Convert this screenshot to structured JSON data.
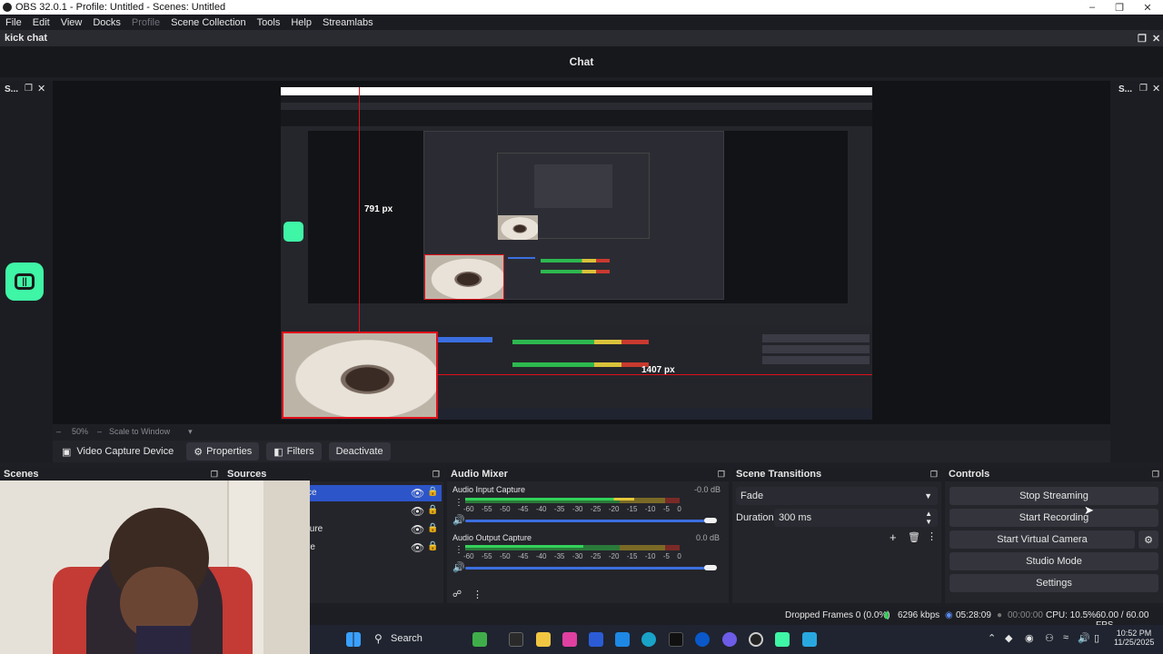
{
  "window": {
    "title": "OBS 32.0.1 - Profile: Untitled - Scenes: Untitled"
  },
  "menu": [
    "File",
    "Edit",
    "View",
    "Docks",
    "Profile",
    "Scene Collection",
    "Tools",
    "Help",
    "Streamlabs"
  ],
  "dock_title": "kick chat",
  "chat": {
    "title": "Chat"
  },
  "left_dock": {
    "label": "S..."
  },
  "right_dock": {
    "label": "S..."
  },
  "preview": {
    "measure_vertical": "791 px",
    "measure_horizontal": "1407 px"
  },
  "zoom": {
    "value": "50%",
    "mode": "Scale to Window"
  },
  "source_toolbar": {
    "source_name": "Video Capture Device",
    "properties": "Properties",
    "filters": "Filters",
    "deactivate": "Deactivate"
  },
  "docks": {
    "scenes": "Scenes",
    "sources": "Sources",
    "audio_mixer": "Audio Mixer",
    "scene_transitions": "Scene Transitions",
    "controls": "Controls"
  },
  "sources_list": [
    "ce",
    "",
    "ture",
    "re"
  ],
  "mixer": {
    "channels": [
      {
        "name": "Audio Input Capture",
        "db": "-0.0 dB",
        "level": 0.78
      },
      {
        "name": "Audio Output Capture",
        "db": "0.0 dB",
        "level": 0.52
      }
    ],
    "scale": [
      "-60",
      "-55",
      "-50",
      "-45",
      "-40",
      "-35",
      "-30",
      "-25",
      "-20",
      "-15",
      "-10",
      "-5",
      "0"
    ]
  },
  "transitions": {
    "selected": "Fade",
    "duration_label": "Duration",
    "duration_value": "300 ms"
  },
  "controls": {
    "stop_streaming": "Stop Streaming",
    "start_recording": "Start Recording",
    "start_virtual_camera": "Start Virtual Camera",
    "studio_mode": "Studio Mode",
    "settings": "Settings"
  },
  "status": {
    "dropped": "Dropped Frames 0 (0.0%)",
    "bitrate": "6296 kbps",
    "stream_time": "05:28:09",
    "record_time": "00:00:00",
    "cpu": "CPU: 10.5%",
    "fps": "60.00 / 60.00 FPS"
  },
  "taskbar": {
    "search": "Search",
    "time": "10:52 PM",
    "date": "11/25/2025"
  },
  "colors": {
    "accent": "#3b6fe0",
    "kick_green": "#3ff5a6",
    "guide_red": "#e0101a"
  }
}
